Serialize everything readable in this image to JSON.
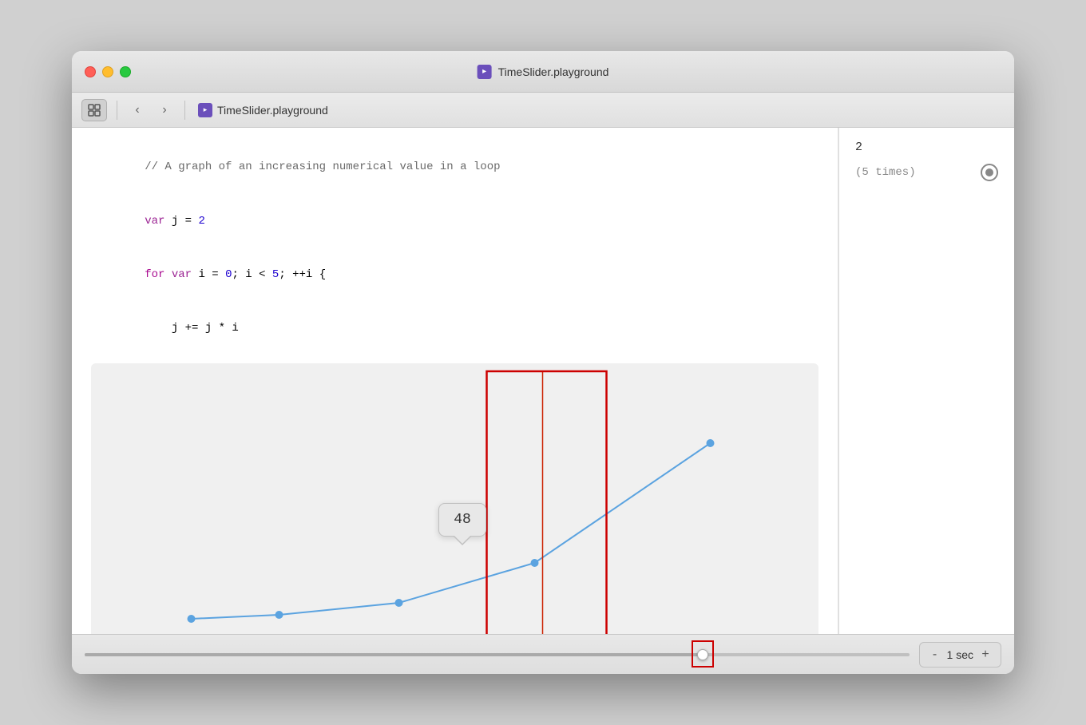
{
  "window": {
    "title": "TimeSlider.playground",
    "file_name": "TimeSlider.playground"
  },
  "toolbar": {
    "back_label": "‹",
    "forward_label": "›",
    "file_name": "TimeSlider.playground"
  },
  "code": {
    "comment": "// A graph of an increasing numerical value in a loop",
    "line2": "var j = 2",
    "line3": "for var i = 0; i < 5; ++i {",
    "line4": "    j += j * i",
    "closing": "}"
  },
  "results": {
    "value": "2",
    "times_label": "(5 times)"
  },
  "graph": {
    "tooltip_value": "48"
  },
  "bottom_bar": {
    "minus_label": "-",
    "plus_label": "+",
    "time_value": "1 sec"
  },
  "icons": {
    "grid": "grid-icon",
    "playground": "playground-icon",
    "circle": "circle-icon"
  }
}
